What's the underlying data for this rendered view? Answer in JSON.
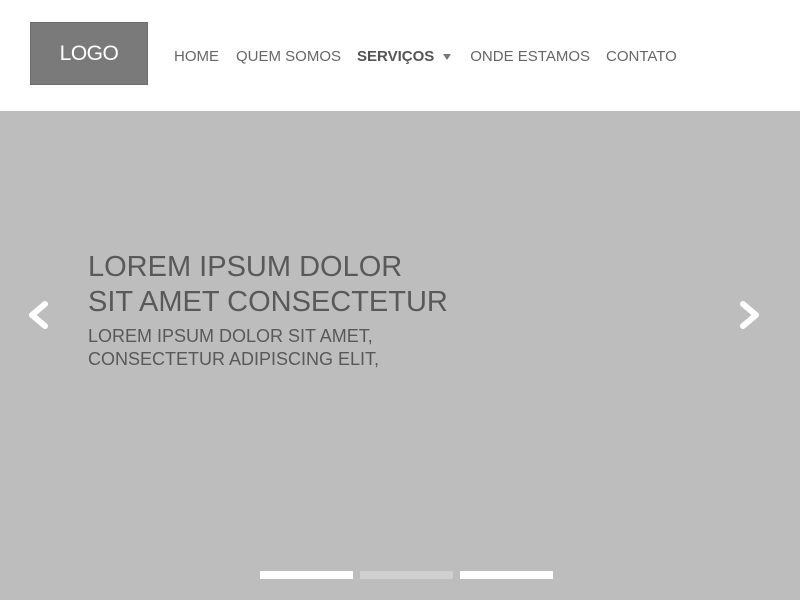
{
  "header": {
    "logo_text": "LOGO",
    "nav": [
      {
        "label": "HOME"
      },
      {
        "label": "QUEM SOMOS"
      },
      {
        "label": "SERVIÇOS",
        "active": true,
        "has_dropdown": true
      },
      {
        "label": "ONDE ESTAMOS"
      },
      {
        "label": "CONTATO"
      }
    ]
  },
  "slider": {
    "title_line1": "LOREM IPSUM DOLOR",
    "title_line2": "SIT AMET CONSECTETUR",
    "subtitle_line1": "LOREM IPSUM DOLOR SIT AMET,",
    "subtitle_line2": "CONSECTETUR ADIPISCING ELIT,",
    "prev_icon": "chevron-left-icon",
    "next_icon": "chevron-right-icon",
    "indicators": [
      {
        "state": "inactive",
        "color": "#ffffff"
      },
      {
        "state": "active",
        "color": "#d0d0d0"
      },
      {
        "state": "inactive",
        "color": "#ffffff"
      }
    ]
  },
  "colors": {
    "logo_bg": "#7a7a7a",
    "hero_bg": "#bdbdbd",
    "text": "#595959"
  }
}
